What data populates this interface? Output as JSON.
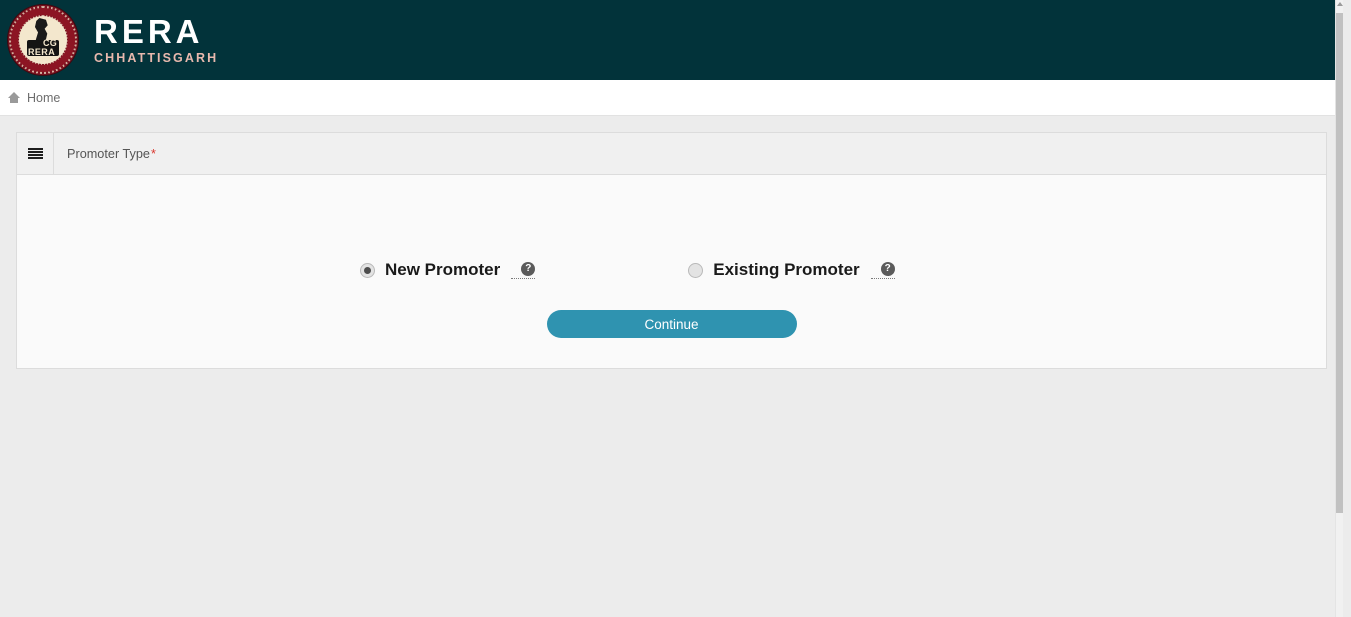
{
  "header": {
    "logo_icon": "cg-rera-emblem-icon",
    "emblem_arc_top": "CHHATTISGARH REAL ESTATE REGULATORY AUTHORITY",
    "emblem_arc_bottom": "RAIPUR",
    "emblem_cg": "CG",
    "emblem_rera": "RERA",
    "title": "RERA",
    "subtitle": "CHHATTISGARH",
    "bg_color": "#02333a",
    "title_color": "#ffffff",
    "subtitle_color": "#e8b9ae"
  },
  "breadcrumb": {
    "home_icon": "home-icon",
    "home_label": "Home"
  },
  "panel": {
    "menu_icon": "hamburger-bars-icon",
    "title": "Promoter Type",
    "required_marker": "*",
    "required_color": "#d9342b"
  },
  "options": [
    {
      "id": "new-promoter",
      "label": "New Promoter",
      "selected": true,
      "help_icon": "question-mark-circle-icon",
      "help_glyph": "?"
    },
    {
      "id": "existing-promoter",
      "label": "Existing Promoter",
      "selected": false,
      "help_icon": "question-mark-circle-icon",
      "help_glyph": "?"
    }
  ],
  "actions": {
    "continue_label": "Continue",
    "continue_color": "#2f93b0"
  },
  "scrollbar": {
    "up_arrow_icon": "scroll-up-arrow-icon",
    "thumb_color": "#c1c1c1"
  }
}
